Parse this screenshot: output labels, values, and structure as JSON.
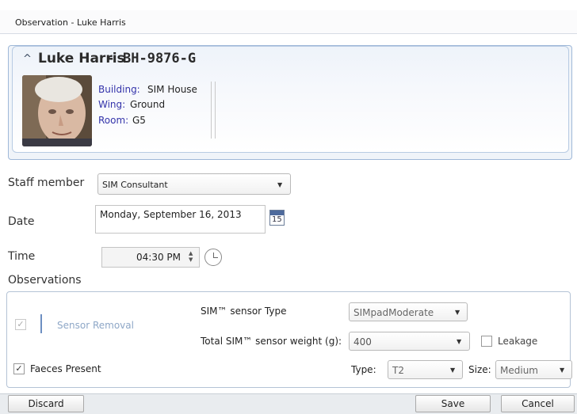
{
  "window": {
    "title": "Observation - Luke Harris"
  },
  "resident": {
    "name": "Luke Harris",
    "separator": "-",
    "id": "BH-9876-G",
    "building_label": "Building:",
    "building_value": "SIM House",
    "wing_label": "Wing:",
    "wing_value": "Ground",
    "room_label": "Room:",
    "room_value": "G5"
  },
  "form": {
    "staff_label": "Staff member",
    "staff_value": "SIM Consultant",
    "date_label": "Date",
    "date_value": "Monday, September 16, 2013",
    "calendar_day": "15",
    "time_label": "Time",
    "time_value": "04:30 PM",
    "observations_label": "Observations"
  },
  "observations": {
    "sensor_removal_label": "Sensor Removal",
    "sensor_type_label": "SIM™ sensor Type",
    "sensor_type_value": "SIMpadModerate",
    "sensor_weight_label": "Total SIM™ sensor weight (g):",
    "sensor_weight_value": "400",
    "leakage_label": "Leakage",
    "faeces_label": "Faeces Present",
    "type_label": "Type:",
    "type_value": "T2",
    "size_label": "Size:",
    "size_value": "Medium"
  },
  "buttons": {
    "discard": "Discard",
    "save": "Save",
    "cancel": "Cancel"
  }
}
